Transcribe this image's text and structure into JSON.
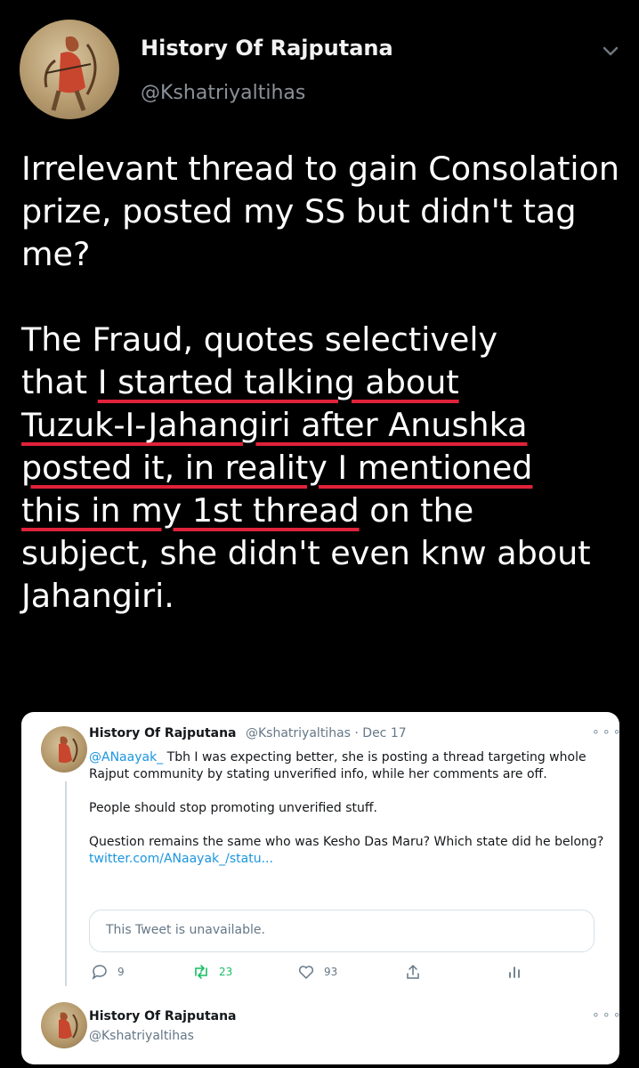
{
  "header": {
    "display_name": "History Of Rajputana",
    "handle": "@Kshatriyaltihas"
  },
  "tweet": {
    "para1": "Irrelevant thread to gain Consolation prize, posted my SS but didn't tag me?",
    "l1": "The Fraud, quotes selectively",
    "l2a": "that ",
    "l2u": "I started talking about",
    "l3u": "Tuzuk-I-Jahangiri after Anushka",
    "l4u": "posted it, in reality I mentioned",
    "l5u": "this in my 1st thread",
    "l5b": " on the",
    "l6": "subject, she didn't even knw about",
    "l7": "Jahangiri."
  },
  "embedded": {
    "name": "History Of Rajputana",
    "meta": "@Kshatriyaltihas · Dec 17",
    "dots": "⚬⚬⚬",
    "mention": "@ANaayak_",
    "line1": " Tbh I was expecting better, she is posting a thread targeting whole Rajput community by stating unverified info, while her comments are off.",
    "line2": "People should stop promoting unverified stuff.",
    "line3": "Question remains the same who was Kesho Das Maru? Which state did he belong? ",
    "link": "twitter.com/ANaayak_/statu...",
    "unavailable": "This Tweet is unavailable.",
    "replies": "9",
    "retweets": "23",
    "likes": "93",
    "reply_name": "History Of Rajputana",
    "reply_handle": "@Kshatriyaltihas",
    "reply_dots": "⚬⚬⚬"
  },
  "colors": {
    "background": "#000000",
    "underline": "#e0223a",
    "link": "#1b95e0",
    "retweet": "#17bf63"
  }
}
